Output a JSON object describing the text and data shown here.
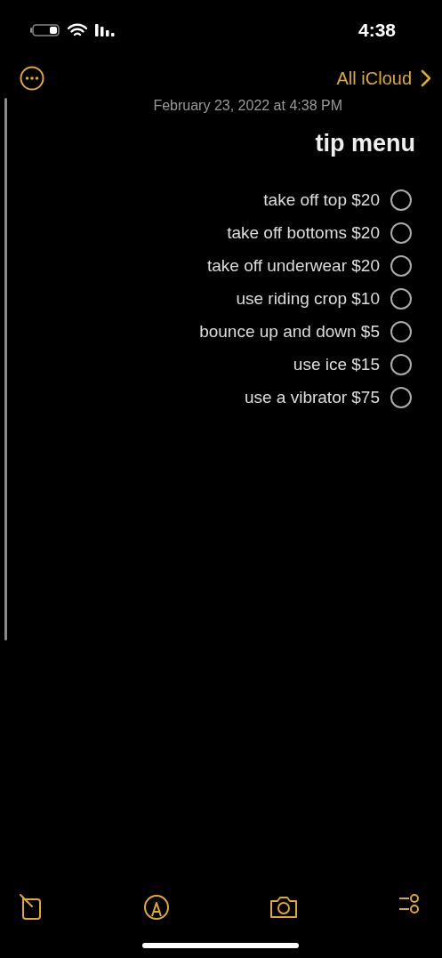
{
  "status_bar": {
    "time": "4:38"
  },
  "nav": {
    "back_label": "All iCloud"
  },
  "note": {
    "date": "February 23, 2022 at 4:38 PM",
    "title": "tip menu",
    "checklist": [
      {
        "text": "take off top $20",
        "checked": false
      },
      {
        "text": "take off bottoms $20",
        "checked": false
      },
      {
        "text": "take off underwear $20",
        "checked": false
      },
      {
        "text": "use riding crop $10",
        "checked": false
      },
      {
        "text": "bounce up and down $5",
        "checked": false
      },
      {
        "text": "use ice $15",
        "checked": false
      },
      {
        "text": "use a vibrator $75",
        "checked": false
      }
    ]
  }
}
